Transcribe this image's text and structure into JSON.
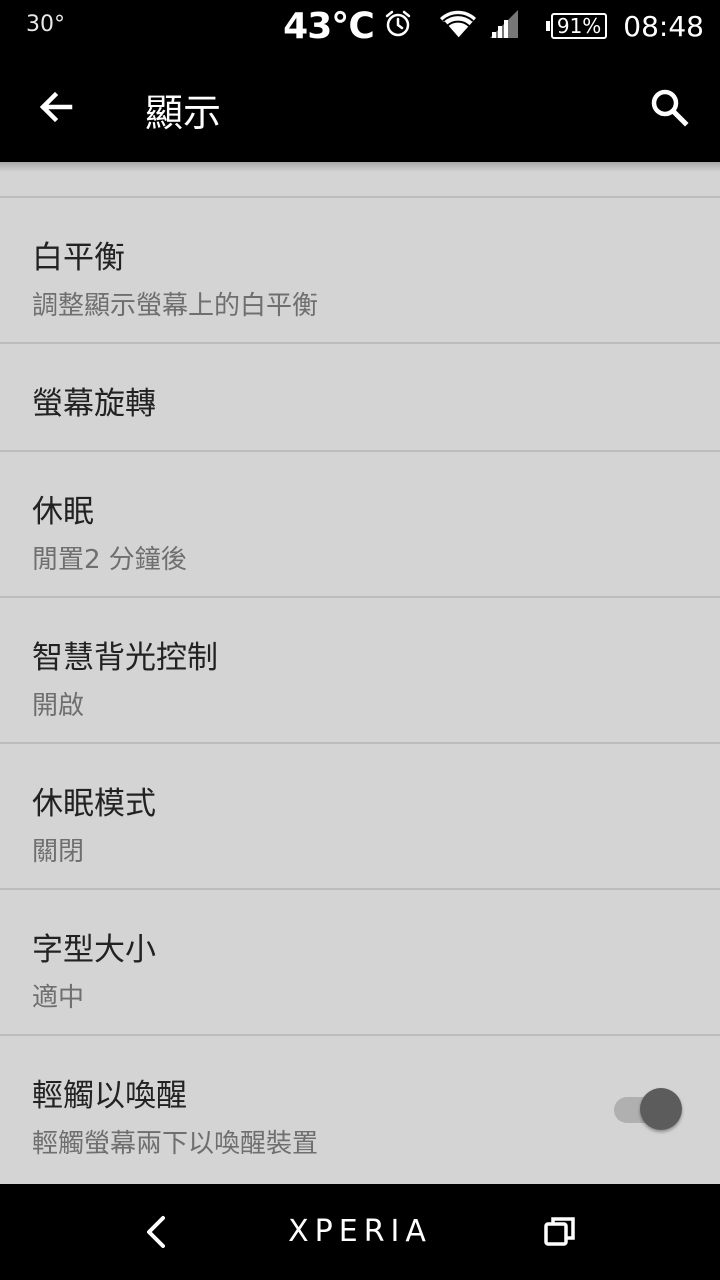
{
  "status_bar": {
    "left_temp": "30°",
    "temperature": "43℃",
    "battery": "91%",
    "time": "08:48",
    "icons": [
      "alarm-icon",
      "wifi-icon",
      "signal-icon",
      "battery-icon"
    ]
  },
  "toolbar": {
    "title": "顯示",
    "back_icon": "back-arrow-icon",
    "search_icon": "search-icon"
  },
  "settings": [
    {
      "title": "白平衡",
      "summary": "調整顯示螢幕上的白平衡"
    },
    {
      "title": "螢幕旋轉"
    },
    {
      "title": "休眠",
      "summary": "閒置2 分鐘後"
    },
    {
      "title": "智慧背光控制",
      "summary": "開啟"
    },
    {
      "title": "休眠模式",
      "summary": "關閉"
    },
    {
      "title": "字型大小",
      "summary": "適中"
    },
    {
      "title": "輕觸以喚醒",
      "summary": "輕觸螢幕兩下以喚醒裝置",
      "toggle_on": true
    }
  ],
  "nav_bar": {
    "brand": "XPERIA",
    "icons": [
      "nav-back-icon",
      "recents-icon"
    ]
  },
  "colors": {
    "bar_background": "#000000",
    "list_background": "#d4d4d4",
    "divider": "#bdbdbd",
    "title_text": "#222222",
    "summary_text": "#6f6f6f"
  }
}
